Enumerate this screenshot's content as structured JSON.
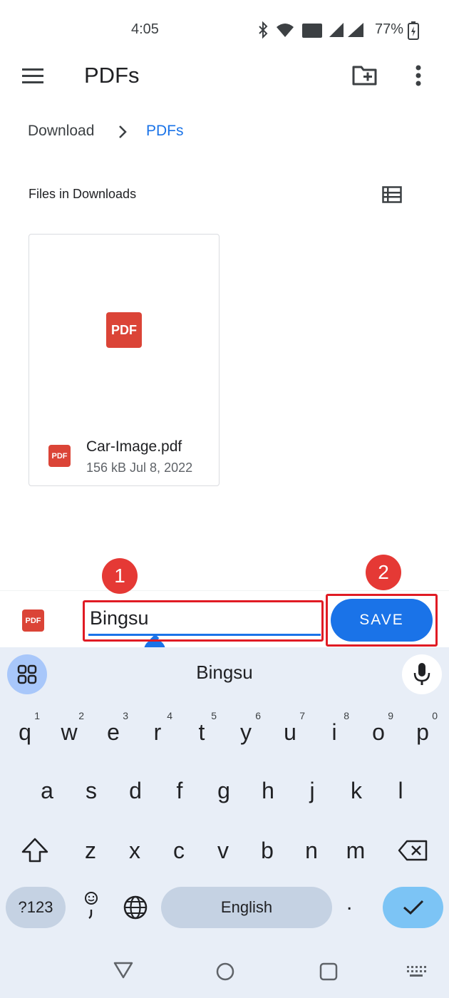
{
  "status": {
    "time": "4:05",
    "battery": "77%"
  },
  "appbar": {
    "title": "PDFs"
  },
  "breadcrumb": {
    "parent": "Download",
    "current": "PDFs"
  },
  "section": {
    "label": "Files in Downloads"
  },
  "file": {
    "thumb_label": "PDF",
    "icon_label": "PDF",
    "name": "Car-Image.pdf",
    "meta": "156 kB Jul 8, 2022"
  },
  "save_bar": {
    "icon_label": "PDF",
    "filename_value": "Bingsu",
    "save_label": "SAVE"
  },
  "annotations": {
    "step1": "1",
    "step2": "2"
  },
  "keyboard": {
    "suggestion": "Bingsu",
    "row1": [
      {
        "k": "q",
        "h": "1"
      },
      {
        "k": "w",
        "h": "2"
      },
      {
        "k": "e",
        "h": "3"
      },
      {
        "k": "r",
        "h": "4"
      },
      {
        "k": "t",
        "h": "5"
      },
      {
        "k": "y",
        "h": "6"
      },
      {
        "k": "u",
        "h": "7"
      },
      {
        "k": "i",
        "h": "8"
      },
      {
        "k": "o",
        "h": "9"
      },
      {
        "k": "p",
        "h": "0"
      }
    ],
    "row2": [
      "a",
      "s",
      "d",
      "f",
      "g",
      "h",
      "j",
      "k",
      "l"
    ],
    "row3": [
      "z",
      "x",
      "c",
      "v",
      "b",
      "n",
      "m"
    ],
    "symbols_label": "?123",
    "space_label": "English",
    "period_label": "."
  },
  "colors": {
    "accent": "#1a73e8",
    "pdf_red": "#db4437",
    "highlight": "#e01b24"
  }
}
